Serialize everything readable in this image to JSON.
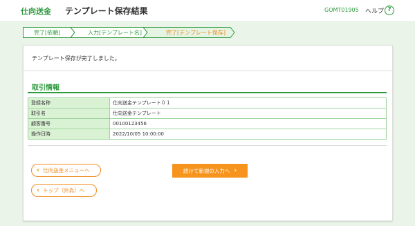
{
  "header": {
    "app_title": "仕向送金",
    "page_title": "テンプレート保存結果",
    "screen_id": "GOMT01905",
    "help_label": "ヘルプ",
    "help_icon": "?"
  },
  "steps": [
    {
      "label": "完了[依頼]",
      "state": "done"
    },
    {
      "label": "入力[テンプレート名]",
      "state": "done"
    },
    {
      "label": "完了[テンプレート保存]",
      "state": "current"
    }
  ],
  "main": {
    "complete_message": "テンプレート保存が完了しました。",
    "section_title": "取引情報",
    "rows": [
      {
        "label": "登録名称",
        "value": "仕向送金テンプレート０１"
      },
      {
        "label": "取引名",
        "value": "仕向送金テンプレート"
      },
      {
        "label": "顧客番号",
        "value": "00100123456"
      },
      {
        "label": "操作日時",
        "value": "2022/10/05 10:00:00"
      }
    ]
  },
  "buttons": {
    "back_menu": "仕向送金メニューへ",
    "back_top": "トップ（外為）へ",
    "continue": "続けて新規の入力へ",
    "back_chevron": "‹",
    "forward_chevron": "›"
  },
  "colors": {
    "brand_green": "#2c9a3d",
    "accent_orange": "#f7941d",
    "background": "#eaf4e9",
    "table_header": "#d9f2d4"
  }
}
